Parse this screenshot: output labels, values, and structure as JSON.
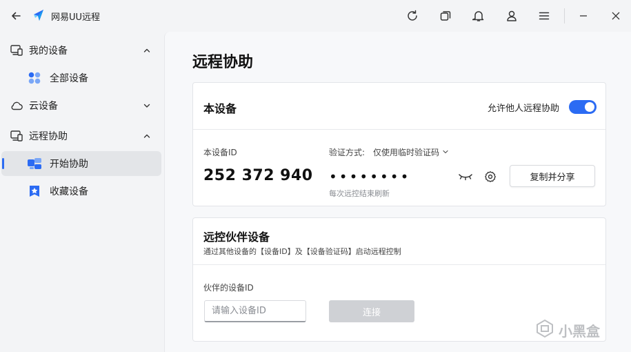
{
  "app": {
    "title": "网易UU远程"
  },
  "titlebar": {
    "icons": [
      "back-arrow-icon",
      "refresh-icon",
      "window-switch-icon",
      "bell-icon",
      "user-icon",
      "menu-icon",
      "minimize-icon",
      "close-icon"
    ]
  },
  "sidebar": {
    "groups": [
      {
        "label": "我的设备",
        "expanded": true,
        "items": [
          {
            "label": "全部设备"
          }
        ]
      },
      {
        "label": "云设备",
        "expanded": false
      },
      {
        "label": "远程协助",
        "expanded": true,
        "items": [
          {
            "label": "开始协助",
            "active": true
          },
          {
            "label": "收藏设备"
          }
        ]
      }
    ]
  },
  "main": {
    "title": "远程协助",
    "this_device": {
      "title": "本设备",
      "allow_label": "允许他人远程协助",
      "allow_enabled": true,
      "id_label": "本设备ID",
      "id_value": "252 372 940",
      "verify_label": "验证方式:",
      "verify_mode": "仅使用临时验证码",
      "code_mask": "••••••••",
      "refresh_hint": "每次远控结束刷新",
      "copy_button": "复制并分享"
    },
    "partner": {
      "title": "远控伙伴设备",
      "subtitle": "通过其他设备的【设备ID】及【设备验证码】启动远程控制",
      "field_label": "伙伴的设备ID",
      "input_placeholder": "请输入设备ID",
      "connect_button": "连接"
    }
  },
  "watermark": {
    "text": "小黑盒"
  },
  "colors": {
    "accent": "#2b6bf3",
    "disabled": "#cfd1d5"
  }
}
